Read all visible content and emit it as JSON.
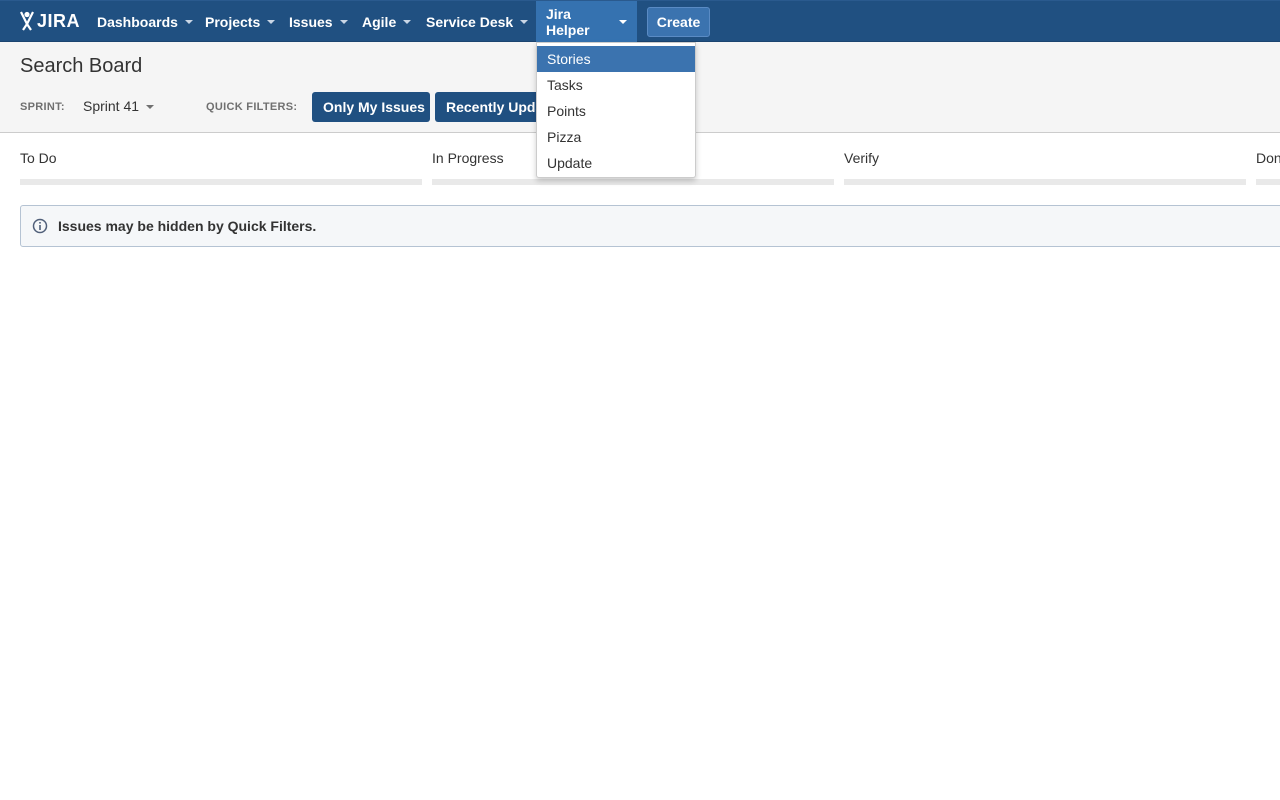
{
  "app": {
    "logo_text": "JIRA"
  },
  "nav": {
    "items": [
      {
        "label": "Dashboards"
      },
      {
        "label": "Projects"
      },
      {
        "label": "Issues"
      },
      {
        "label": "Agile"
      },
      {
        "label": "Service Desk"
      },
      {
        "label": "Jira Helper"
      }
    ],
    "create_label": "Create"
  },
  "header": {
    "title": "Search Board",
    "sprint_label": "SPRINT:",
    "sprint_value": "Sprint 41",
    "quick_filters_label": "QUICK FILTERS:",
    "quick_filters": [
      {
        "label": "Only My Issues"
      },
      {
        "label": "Recently Updated"
      }
    ]
  },
  "board": {
    "columns": [
      {
        "label": "To Do"
      },
      {
        "label": "In Progress"
      },
      {
        "label": "Verify"
      },
      {
        "label": "Done"
      }
    ],
    "info_message": "Issues may be hidden by Quick Filters."
  },
  "dropdown": {
    "items": [
      {
        "label": "Stories",
        "selected": true
      },
      {
        "label": "Tasks",
        "selected": false
      },
      {
        "label": "Points",
        "selected": false
      },
      {
        "label": "Pizza",
        "selected": false
      },
      {
        "label": "Update",
        "selected": false
      }
    ]
  },
  "icons": {
    "logo": "jira-logo-icon",
    "caret": "chevron-down-icon",
    "info": "info-icon"
  },
  "colors": {
    "nav_bg": "#205081",
    "nav_active": "#3572b0",
    "create_bg": "#3b73af",
    "quick_filter_bg": "#205081",
    "dropdown_selected": "#3b73af"
  }
}
